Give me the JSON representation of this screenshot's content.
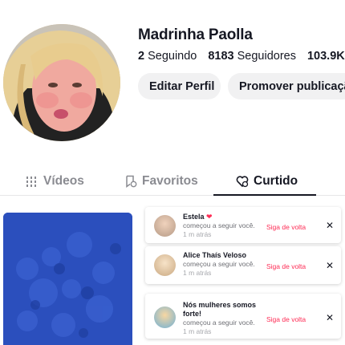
{
  "profile": {
    "username": "Madrinha Paolla",
    "following_count": "2",
    "following_label": "Seguindo",
    "followers_count": "8183",
    "followers_label": "Seguidores",
    "likes_count": "103.9K"
  },
  "actions": {
    "edit_profile": "Editar Perfil",
    "promote": "Promover publicação"
  },
  "tabs": [
    {
      "label": "Vídeos",
      "icon": "grid-icon",
      "active": false
    },
    {
      "label": "Favoritos",
      "icon": "bookmark-icon",
      "active": false
    },
    {
      "label": "Curtido",
      "icon": "heart-icon",
      "active": true
    }
  ],
  "notifications": [
    {
      "name": "Estela",
      "action": "começou a seguir você.",
      "time": "1 m atrás",
      "button": "Siga de volta",
      "close": "✕"
    },
    {
      "name": "Alice Thaís Veloso",
      "action": "começou a seguir você.",
      "time": "1 m atrás",
      "button": "Siga de volta",
      "close": "✕"
    },
    {
      "name": "Nós mulheres somos forte!",
      "action": "começou a seguir você.",
      "time": "1 m atrás",
      "button": "Siga de volta",
      "close": "✕"
    }
  ],
  "colors": {
    "accent": "#fe2c55",
    "text": "#161823",
    "muted": "#8a8b91",
    "button_bg": "#f1f1f2",
    "thumb_blue": "#2a4fb8"
  }
}
